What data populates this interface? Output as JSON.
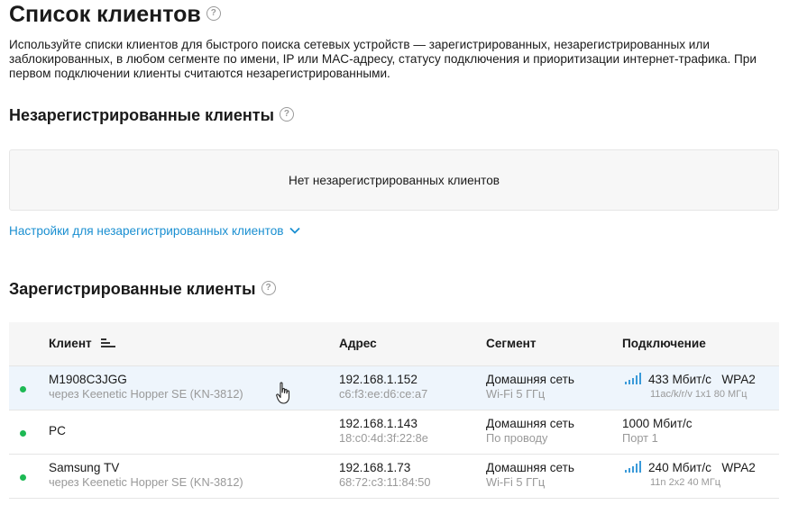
{
  "page": {
    "title": "Список клиентов",
    "description": "Используйте списки клиентов для быстрого поиска сетевых устройств — зарегистрированных, незарегистрированных или заблокированных, в любом сегменте по имени, IP или MAC-адресу, статусу подключения и приоритизации интернет-трафика. При первом подключении клиенты считаются незарегистрированными."
  },
  "unregistered": {
    "title": "Незарегистрированные клиенты",
    "empty_text": "Нет незарегистрированных клиентов",
    "settings_link": "Настройки для незарегистрированных клиентов"
  },
  "registered": {
    "title": "Зарегистрированные клиенты",
    "columns": {
      "client": "Клиент",
      "address": "Адрес",
      "segment": "Сегмент",
      "connection": "Подключение"
    },
    "rows": [
      {
        "name": "M1908C3JGG",
        "via": "через Keenetic Hopper SE (KN-3812)",
        "ip": "192.168.1.152",
        "mac": "c6:f3:ee:d6:ce:a7",
        "segment": "Домашняя сеть",
        "medium": "Wi-Fi 5 ГГц",
        "speed": "433 Мбит/с",
        "security": "WPA2",
        "detail": "11ac/k/r/v 1x1 80 МГц"
      },
      {
        "name": "PC",
        "via": "",
        "ip": "192.168.1.143",
        "mac": "18:c0:4d:3f:22:8e",
        "segment": "Домашняя сеть",
        "medium": "По проводу",
        "speed": "1000 Мбит/с",
        "security": "",
        "detail": "Порт 1"
      },
      {
        "name": "Samsung TV",
        "via": "через Keenetic Hopper SE (KN-3812)",
        "ip": "192.168.1.73",
        "mac": "68:72:c3:11:84:50",
        "segment": "Домашняя сеть",
        "medium": "Wi-Fi 5 ГГц",
        "speed": "240 Мбит/с",
        "security": "WPA2",
        "detail": "11n 2x2 40 МГц"
      }
    ]
  },
  "icons": {
    "help": "help-icon",
    "chevron": "chevron-down-icon",
    "sort": "sort-icon",
    "wifi": "wifi-signal-icon",
    "status": "online-status-icon",
    "cursor": "hand-cursor-icon"
  },
  "colors": {
    "accent": "#1a8fd1",
    "online": "#1db954",
    "muted": "#999999",
    "row_hover": "#eef5fc"
  }
}
